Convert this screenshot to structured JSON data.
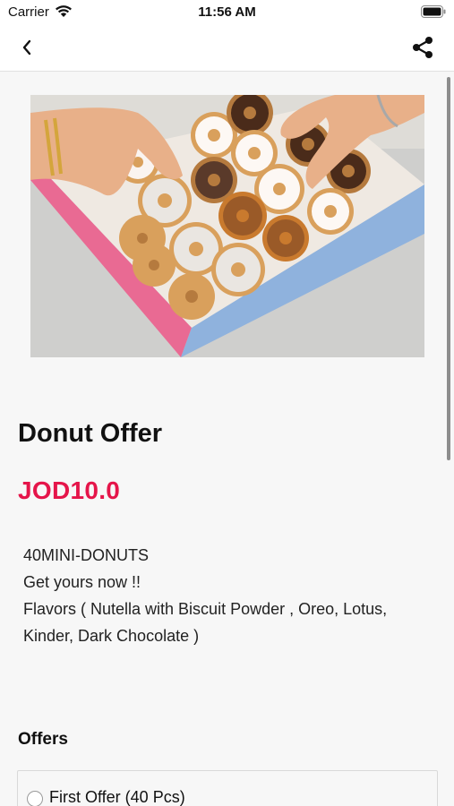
{
  "status_bar": {
    "carrier": "Carrier",
    "time": "11:56 AM"
  },
  "nav": {
    "back_icon": "chevron-left-icon",
    "share_icon": "share-icon"
  },
  "product": {
    "title": "Donut Offer",
    "price": "JOD10.0",
    "description_lines": [
      "40MINI-DONUTS",
      "Get yours now !!",
      "Flavors ( Nutella with Biscuit Powder , Oreo, Lotus,",
      "Kinder, Dark Chocolate )"
    ]
  },
  "offers": {
    "heading": "Offers",
    "items": [
      {
        "label": "First Offer (40 Pcs)"
      }
    ]
  },
  "colors": {
    "price": "#e5154a",
    "background": "#f7f7f7",
    "bar": "#ffffff"
  }
}
